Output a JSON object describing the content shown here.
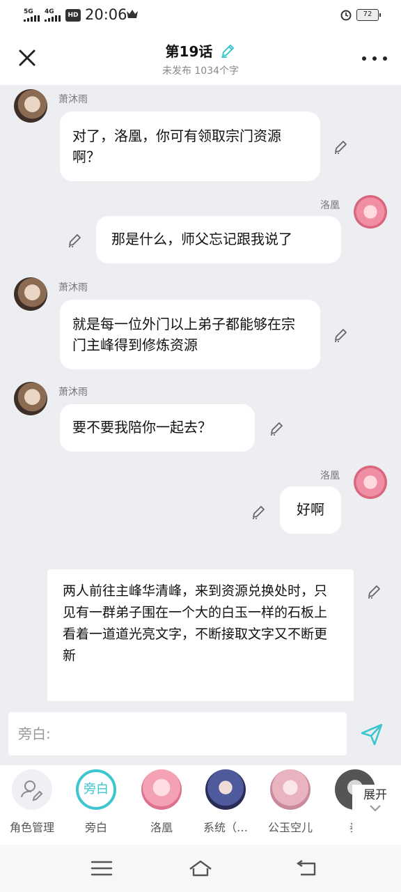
{
  "status_bar": {
    "network1": "5G",
    "network2": "4G",
    "hd": "HD",
    "time": "20:06",
    "battery": "72"
  },
  "header": {
    "title": "第19话",
    "subtitle": "未发布 1034个字"
  },
  "messages": [
    {
      "speaker": "萧沐雨",
      "side": "left",
      "text": "对了，洛凰，你可有领取宗门资源啊？"
    },
    {
      "speaker": "洛凰",
      "side": "right",
      "text": "那是什么，师父忘记跟我说了"
    },
    {
      "speaker": "萧沐雨",
      "side": "left",
      "text": "就是每一位外门以上弟子都能够在宗门主峰得到修炼资源"
    },
    {
      "speaker": "萧沐雨",
      "side": "left",
      "text": "要不要我陪你一起去？"
    },
    {
      "speaker": "洛凰",
      "side": "right",
      "text": "好啊"
    }
  ],
  "narration": "两人前往主峰华清峰，来到资源兑换处时，只见有一群弟子围在一个大的白玉一样的石板上看着一道道光亮文字，不断接取文字又不断更新",
  "input": {
    "placeholder": "旁白:"
  },
  "roles": [
    {
      "label": "角色管理",
      "avatar_text": ""
    },
    {
      "label": "旁白",
      "avatar_text": "旁白"
    },
    {
      "label": "洛凰",
      "avatar_text": ""
    },
    {
      "label": "系统（…",
      "avatar_text": ""
    },
    {
      "label": "公玉空儿",
      "avatar_text": ""
    },
    {
      "label": "秦",
      "avatar_text": ""
    }
  ],
  "expand_label": "展开",
  "colors": {
    "accent": "#3cc6cf",
    "chat_background": "#edeef2",
    "bubble": "#ffffff"
  }
}
